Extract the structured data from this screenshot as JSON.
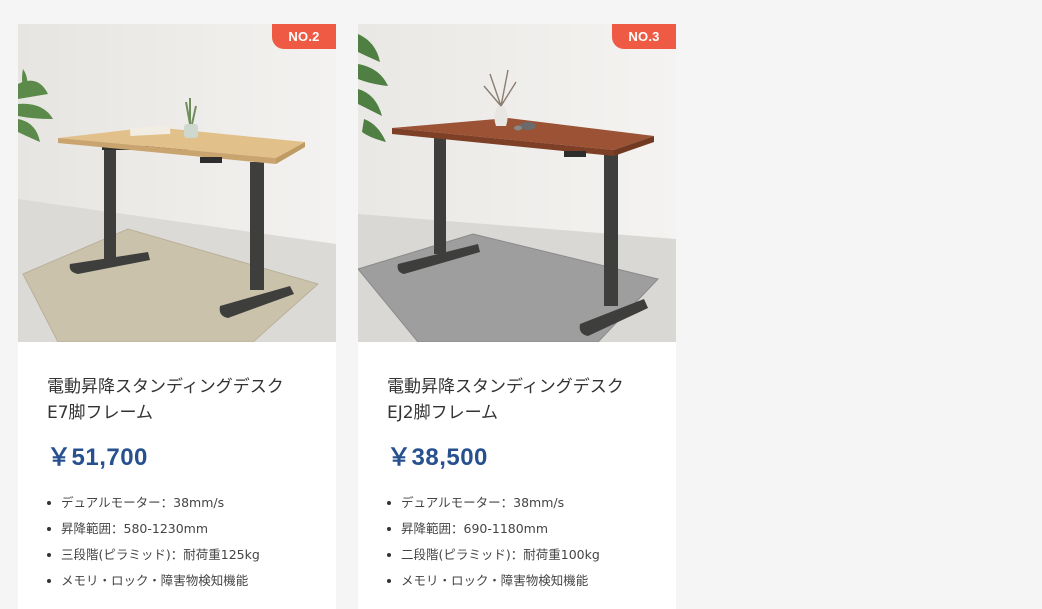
{
  "products": [
    {
      "rank": "NO.2",
      "title_line1": "電動昇降スタンディングデスク",
      "title_line2": "E7脚フレーム",
      "price": "￥51,700",
      "specs": [
        "デュアルモーター：38mm/s",
        "昇降範囲：580-1230mm",
        "三段階(ピラミッド)：耐荷重125kg",
        "メモリ・ロック・障害物検知機能"
      ],
      "desk_top_color": "#e2c08a",
      "frame_color": "#3e3f3d",
      "rug_color": "#cbc2ac"
    },
    {
      "rank": "NO.3",
      "title_line1": "電動昇降スタンディングデスク",
      "title_line2": "EJ2脚フレーム",
      "price": "￥38,500",
      "specs": [
        "デュアルモーター：38mm/s",
        "昇降範囲：690-1180mm",
        "二段階(ピラミッド)：耐荷重100kg",
        "メモリ・ロック・障害物検知機能"
      ],
      "desk_top_color": "#9b5235",
      "frame_color": "#3e3f3d",
      "rug_color": "#9e9e9e"
    }
  ]
}
